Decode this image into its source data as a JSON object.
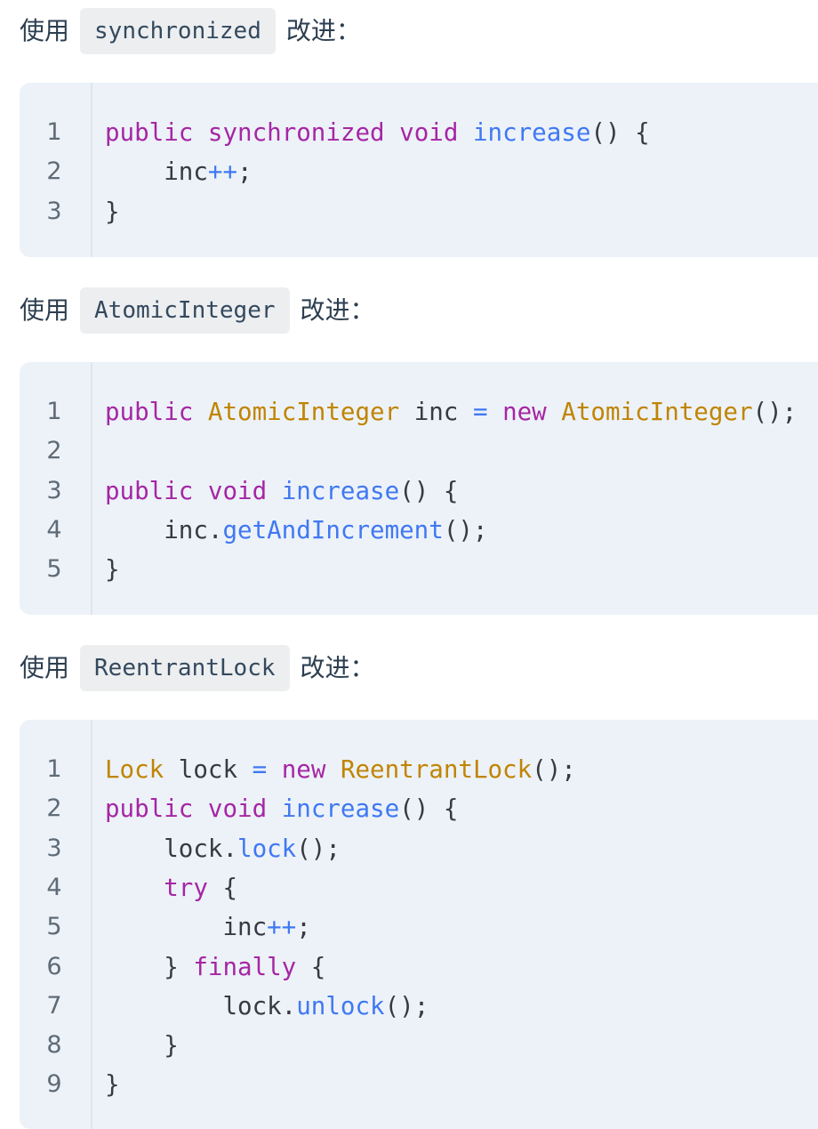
{
  "sections": [
    {
      "prefix": "使用",
      "code_label": "synchronized",
      "suffix": "改进：",
      "code_lines": [
        [
          {
            "t": "kw",
            "s": "public"
          },
          {
            "t": "pl",
            "s": " "
          },
          {
            "t": "kw",
            "s": "synchronized"
          },
          {
            "t": "pl",
            "s": " "
          },
          {
            "t": "kw",
            "s": "void"
          },
          {
            "t": "pl",
            "s": " "
          },
          {
            "t": "fn",
            "s": "increase"
          },
          {
            "t": "pl",
            "s": "() {"
          }
        ],
        [
          {
            "t": "pl",
            "s": "    inc"
          },
          {
            "t": "op",
            "s": "++"
          },
          {
            "t": "pl",
            "s": ";"
          }
        ],
        [
          {
            "t": "pl",
            "s": "}"
          }
        ]
      ]
    },
    {
      "prefix": "使用",
      "code_label": "AtomicInteger",
      "suffix": "改进：",
      "code_lines": [
        [
          {
            "t": "kw",
            "s": "public"
          },
          {
            "t": "pl",
            "s": " "
          },
          {
            "t": "ty",
            "s": "AtomicInteger"
          },
          {
            "t": "pl",
            "s": " inc "
          },
          {
            "t": "op",
            "s": "="
          },
          {
            "t": "pl",
            "s": " "
          },
          {
            "t": "kw",
            "s": "new"
          },
          {
            "t": "pl",
            "s": " "
          },
          {
            "t": "ty",
            "s": "AtomicInteger"
          },
          {
            "t": "pl",
            "s": "();"
          }
        ],
        [],
        [
          {
            "t": "kw",
            "s": "public"
          },
          {
            "t": "pl",
            "s": " "
          },
          {
            "t": "kw",
            "s": "void"
          },
          {
            "t": "pl",
            "s": " "
          },
          {
            "t": "fn",
            "s": "increase"
          },
          {
            "t": "pl",
            "s": "() {"
          }
        ],
        [
          {
            "t": "pl",
            "s": "    inc."
          },
          {
            "t": "fn",
            "s": "getAndIncrement"
          },
          {
            "t": "pl",
            "s": "();"
          }
        ],
        [
          {
            "t": "pl",
            "s": "}"
          }
        ]
      ]
    },
    {
      "prefix": "使用",
      "code_label": "ReentrantLock",
      "suffix": "改进：",
      "code_lines": [
        [
          {
            "t": "ty",
            "s": "Lock"
          },
          {
            "t": "pl",
            "s": " lock "
          },
          {
            "t": "op",
            "s": "="
          },
          {
            "t": "pl",
            "s": " "
          },
          {
            "t": "kw",
            "s": "new"
          },
          {
            "t": "pl",
            "s": " "
          },
          {
            "t": "ty",
            "s": "ReentrantLock"
          },
          {
            "t": "pl",
            "s": "();"
          }
        ],
        [
          {
            "t": "kw",
            "s": "public"
          },
          {
            "t": "pl",
            "s": " "
          },
          {
            "t": "kw",
            "s": "void"
          },
          {
            "t": "pl",
            "s": " "
          },
          {
            "t": "fn",
            "s": "increase"
          },
          {
            "t": "pl",
            "s": "() {"
          }
        ],
        [
          {
            "t": "pl",
            "s": "    lock."
          },
          {
            "t": "fn",
            "s": "lock"
          },
          {
            "t": "pl",
            "s": "();"
          }
        ],
        [
          {
            "t": "pl",
            "s": "    "
          },
          {
            "t": "kw",
            "s": "try"
          },
          {
            "t": "pl",
            "s": " {"
          }
        ],
        [
          {
            "t": "pl",
            "s": "        inc"
          },
          {
            "t": "op",
            "s": "++"
          },
          {
            "t": "pl",
            "s": ";"
          }
        ],
        [
          {
            "t": "pl",
            "s": "    } "
          },
          {
            "t": "kw",
            "s": "finally"
          },
          {
            "t": "pl",
            "s": " {"
          }
        ],
        [
          {
            "t": "pl",
            "s": "        lock."
          },
          {
            "t": "fn",
            "s": "unlock"
          },
          {
            "t": "pl",
            "s": "();"
          }
        ],
        [
          {
            "t": "pl",
            "s": "    }"
          }
        ],
        [
          {
            "t": "pl",
            "s": "}"
          }
        ]
      ]
    }
  ]
}
